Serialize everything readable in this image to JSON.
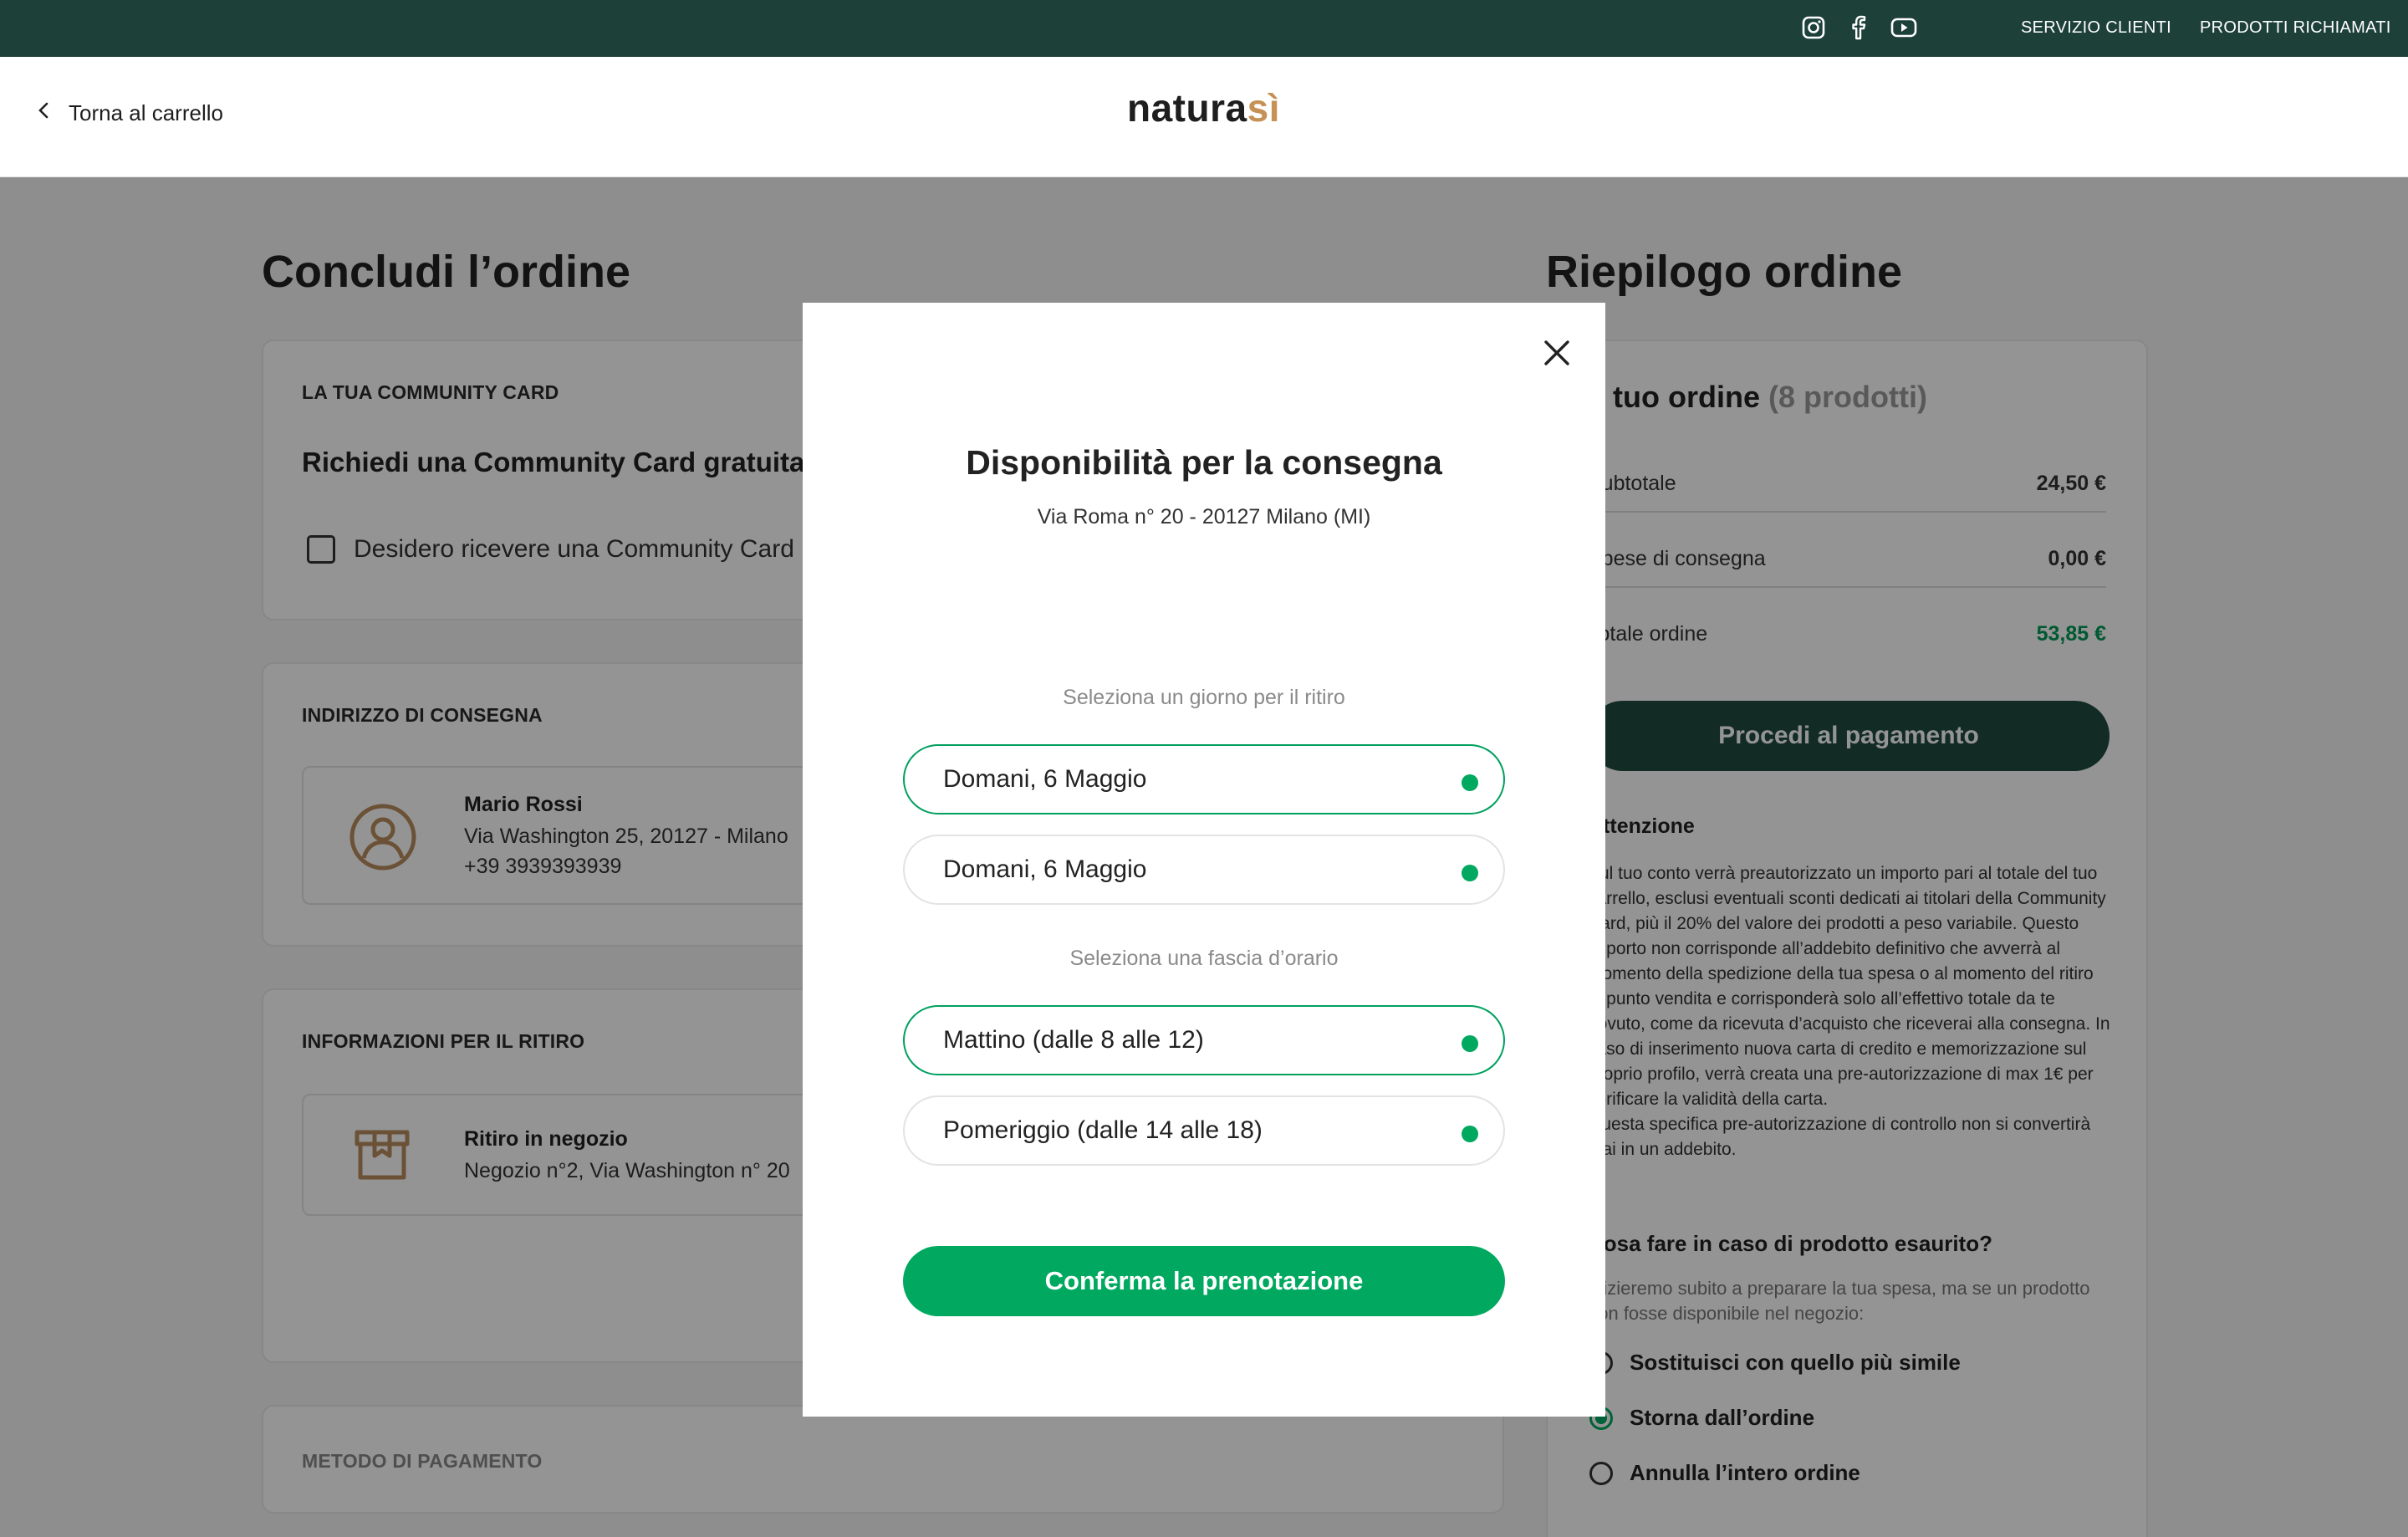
{
  "topbar": {
    "social_icons": [
      "instagram-icon",
      "facebook-icon",
      "youtube-icon"
    ],
    "links": [
      "SERVIZIO CLIENTI",
      "PRODOTTI RICHIAMATI"
    ]
  },
  "header": {
    "back_label": "Torna al carrello",
    "logo_main": "natura",
    "logo_accent": "sì"
  },
  "checkout": {
    "title": "Concludi l’ordine",
    "community": {
      "heading": "LA TUA COMMUNITY CARD",
      "subtitle": "Richiedi una Community Card gratuita",
      "checkbox_label": "Desidero ricevere una Community Card"
    },
    "address": {
      "heading": "INDIRIZZO DI CONSEGNA",
      "name": "Mario Rossi",
      "street": "Via Washington 25, 20127 - Milano",
      "phone": "+39 3939393939"
    },
    "pickup": {
      "heading": "INFORMAZIONI PER IL RITIRO",
      "title": "Ritiro in negozio",
      "store": "Negozio n°2, Via Washington n° 20"
    },
    "payment": {
      "heading": "METODO DI PAGAMENTO"
    }
  },
  "summary": {
    "title": "Riepilogo ordine",
    "order_label": "Il tuo ordine",
    "order_count": "(8 prodotti)",
    "rows": [
      {
        "label": "Subtotale",
        "value": "24,50 €"
      },
      {
        "label": "Spese di consegna",
        "value": "0,00 €"
      },
      {
        "label": "Totale ordine",
        "value": "53,85 €"
      }
    ],
    "pay_button": "Procedi al pagamento",
    "attention_title": "Attenzione",
    "attention_text": "Sul tuo conto verrà preautorizzato un importo pari al totale del tuo carrello, esclusi eventuali sconti dedicati ai titolari della Community Card, più il 20% del valore dei prodotti a peso variabile. Questo importo non corrisponde all’addebito definitivo che avverrà al momento della spedizione della tua spesa o al momento del ritiro in punto vendita e corrisponderà solo all’effettivo totale da te dovuto, come da ricevuta d’acquisto che riceverai alla consegna. In caso di inserimento nuova carta di credito e memorizzazione sul proprio profilo, verrà creata una pre-autorizzazione di max 1€ per verificare la validità della carta.\nQuesta specifica pre-autorizzazione di controllo non si convertirà mai in un addebito.",
    "out_of_stock_title": "Cosa fare in caso di prodotto esaurito?",
    "out_of_stock_text": "Inizieremo subito a preparare la tua spesa, ma se un prodotto non fosse disponibile nel negozio:",
    "options": [
      {
        "label": "Sostituisci con quello più simile",
        "selected": false
      },
      {
        "label": "Storna dall’ordine",
        "selected": true
      },
      {
        "label": "Annulla l’intero ordine",
        "selected": false
      }
    ]
  },
  "modal": {
    "title": "Disponibilità per la consegna",
    "address": "Via Roma n° 20 - 20127 Milano (MI)",
    "day_label": "Seleziona un giorno per il ritiro",
    "days": [
      {
        "label": "Domani, 6 Maggio",
        "selected": true
      },
      {
        "label": "Domani, 6 Maggio",
        "selected": false
      }
    ],
    "slot_label": "Seleziona una fascia d’orario",
    "slots": [
      {
        "label": "Mattino (dalle 8 alle 12)",
        "selected": true
      },
      {
        "label": "Pomeriggio (dalle 14 alle 18)",
        "selected": false
      }
    ],
    "confirm_button": "Conferma la prenotazione"
  },
  "colors": {
    "topbar": "#1d4039",
    "accent_green": "#00a95f",
    "brand_gold": "#c69155",
    "total_green": "#009a56"
  }
}
